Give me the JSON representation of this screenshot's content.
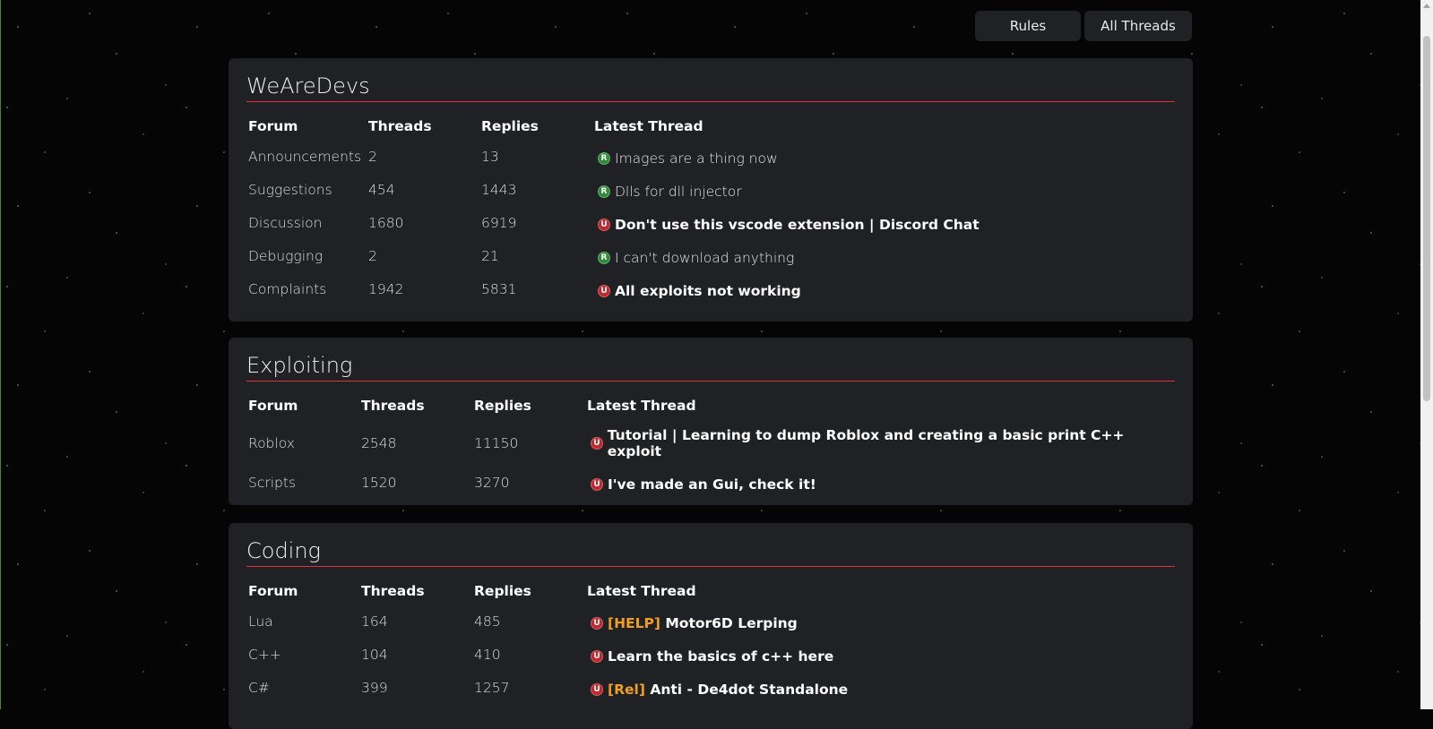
{
  "nav": {
    "rules_label": "Rules",
    "all_threads_label": "All Threads"
  },
  "colors": {
    "accent_red": "#e0303a",
    "badge_read": "#2e8b3a",
    "badge_unread": "#c0282e",
    "tag_orange": "#f0a020",
    "panel_bg": "#202124"
  },
  "sections": [
    {
      "title": "WeAreDevs",
      "headers": {
        "forum": "Forum",
        "threads": "Threads",
        "replies": "Replies",
        "latest": "Latest Thread"
      },
      "rows": [
        {
          "forum": "Announcements",
          "threads": "2",
          "replies": "13",
          "badge": "R",
          "tag": "",
          "latest": "Images are a thing now",
          "unread": false
        },
        {
          "forum": "Suggestions",
          "threads": "454",
          "replies": "1443",
          "badge": "R",
          "tag": "",
          "latest": "Dlls for dll injector",
          "unread": false
        },
        {
          "forum": "Discussion",
          "threads": "1680",
          "replies": "6919",
          "badge": "U",
          "tag": "",
          "latest": "Don't use this vscode extension | Discord Chat",
          "unread": true
        },
        {
          "forum": "Debugging",
          "threads": "2",
          "replies": "21",
          "badge": "R",
          "tag": "",
          "latest": "I can't download anything",
          "unread": false
        },
        {
          "forum": "Complaints",
          "threads": "1942",
          "replies": "5831",
          "badge": "U",
          "tag": "",
          "latest": "All exploits not working",
          "unread": true
        }
      ]
    },
    {
      "title": "Exploiting",
      "headers": {
        "forum": "Forum",
        "threads": "Threads",
        "replies": "Replies",
        "latest": "Latest Thread"
      },
      "rows": [
        {
          "forum": "Roblox",
          "threads": "2548",
          "replies": "11150",
          "badge": "U",
          "tag": "",
          "latest": "Tutorial | Learning to dump Roblox and creating a basic print C++ exploit",
          "unread": true
        },
        {
          "forum": "Scripts",
          "threads": "1520",
          "replies": "3270",
          "badge": "U",
          "tag": "",
          "latest": "I've made an Gui, check it!",
          "unread": true
        }
      ]
    },
    {
      "title": "Coding",
      "headers": {
        "forum": "Forum",
        "threads": "Threads",
        "replies": "Replies",
        "latest": "Latest Thread"
      },
      "rows": [
        {
          "forum": "Lua",
          "threads": "164",
          "replies": "485",
          "badge": "U",
          "tag": "[HELP]",
          "latest": "Motor6D Lerping",
          "unread": true
        },
        {
          "forum": "C++",
          "threads": "104",
          "replies": "410",
          "badge": "U",
          "tag": "",
          "latest": "Learn the basics of c++ here",
          "unread": true
        },
        {
          "forum": "C#",
          "threads": "399",
          "replies": "1257",
          "badge": "U",
          "tag": "[Rel]",
          "latest": "Anti - De4dot Standalone",
          "unread": true
        }
      ]
    }
  ]
}
